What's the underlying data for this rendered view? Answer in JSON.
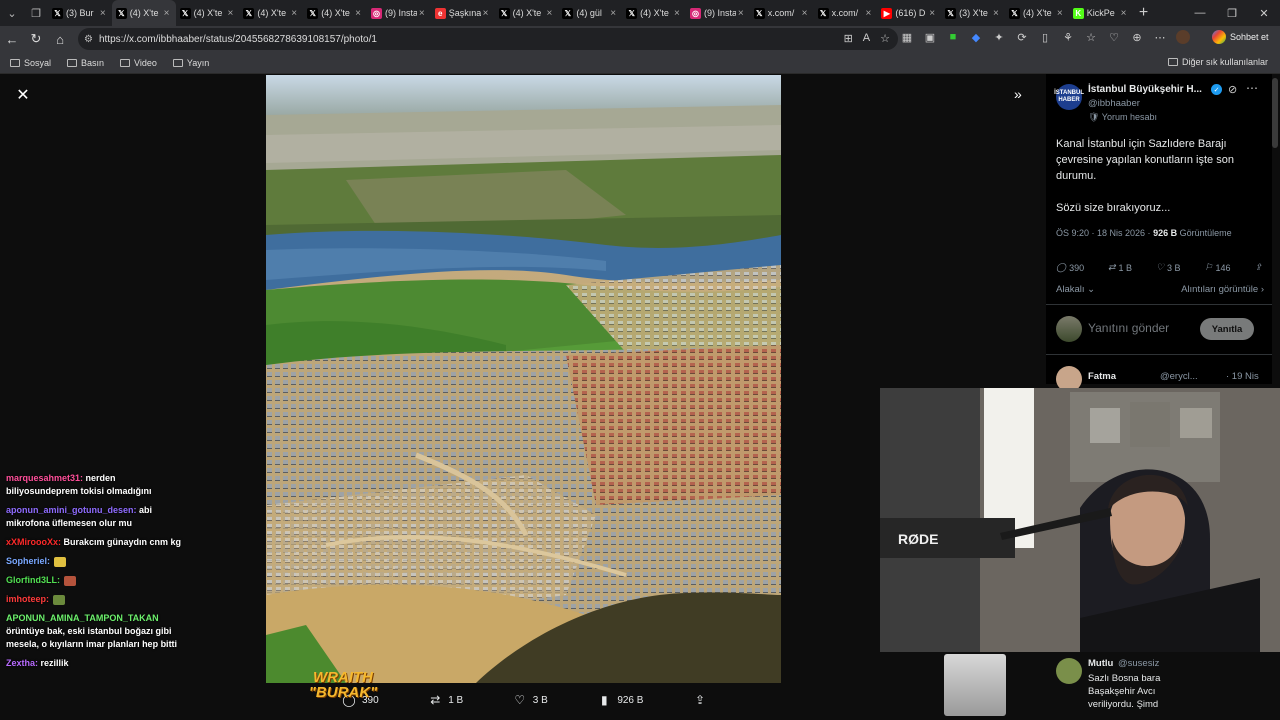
{
  "browser": {
    "tabs": [
      {
        "title": "(3) Bur",
        "icon": "x",
        "active": false
      },
      {
        "title": "(4) X'te",
        "icon": "x",
        "active": true
      },
      {
        "title": "(4) X'te",
        "icon": "x",
        "active": false
      },
      {
        "title": "(4) X'te",
        "icon": "x",
        "active": false
      },
      {
        "title": "(4) X'te",
        "icon": "x",
        "active": false
      },
      {
        "title": "(9) Insta",
        "icon": "instagram",
        "active": false
      },
      {
        "title": "Şaşkına",
        "icon": "ekşi",
        "active": false
      },
      {
        "title": "(4) X'te",
        "icon": "x",
        "active": false
      },
      {
        "title": "(4) gül",
        "icon": "x",
        "active": false
      },
      {
        "title": "(4) X'te",
        "icon": "x",
        "active": false
      },
      {
        "title": "(9) Insta",
        "icon": "instagram",
        "active": false
      },
      {
        "title": "x.com/",
        "icon": "x",
        "active": false
      },
      {
        "title": "x.com/",
        "icon": "x",
        "active": false
      },
      {
        "title": "(616) D",
        "icon": "youtube",
        "active": false
      },
      {
        "title": "(3) X'te",
        "icon": "x",
        "active": false
      },
      {
        "title": "(4) X'te",
        "icon": "x",
        "active": false
      },
      {
        "title": "KickPe",
        "icon": "kick",
        "active": false
      }
    ],
    "url": "https://x.com/ibbhaaber/status/2045568278639108157/photo/1",
    "chat_button": "Sohbet et",
    "bookmarks": [
      "Sosyal",
      "Basın",
      "Video",
      "Yayın"
    ],
    "bookmarks_other": "Diğer sık kullanılanlar"
  },
  "photo_view": {
    "actions": {
      "replies": "390",
      "reposts": "1 B",
      "likes": "3 B",
      "views": "926 B"
    }
  },
  "tweet": {
    "author": "İstanbul Büyükşehir H...",
    "handle": "@ibbhaaber",
    "affiliation": "Yorum hesabı",
    "avatar_text": "İSTANBUL HABER",
    "text_line1": "Kanal İstanbul için Sazlıdere Barajı çevresine yapılan konutların işte son durumu.",
    "text_line2": "Sözü size bırakıyoruz...",
    "time": "ÖS 9:20 · 18 Nis 2026 · ",
    "views": "926 B",
    "views_label": " Görüntüleme",
    "replies": "390",
    "reposts": "1 B",
    "likes": "3 B",
    "bookmarks": "146",
    "related": "Alakalı",
    "quotes": "Alıntıları görüntüle",
    "reply_placeholder": "Yanıtını gönder",
    "reply_button": "Yanıtla"
  },
  "comments": [
    {
      "name": "Fatma",
      "handle": "@erycl...",
      "date": "· 19 Nis"
    },
    {
      "name": "Mutlu",
      "handle": "@susesiz",
      "text": "Sazlı Bosna bara Başakşehir Avcı veriliyordu. Şimd"
    }
  ],
  "stream_chat": [
    {
      "user": "marquesahmet31:",
      "color": "#ff4f9a",
      "text": " nerden biliyosundeprem tokisi olmadığını"
    },
    {
      "user": "aponun_amini_gotunu_desen:",
      "color": "#8f6cff",
      "text": " abi mikrofona üflemesen olur mu"
    },
    {
      "user": "xXMiroooXx:",
      "color": "#ff2a2a",
      "text": " Burakcım günaydın cnm kg"
    },
    {
      "user": "Sopheriel:",
      "color": "#7aa8ff",
      "text": ""
    },
    {
      "user": "Glorfind3LL:",
      "color": "#52e052",
      "text": ""
    },
    {
      "user": "imhoteep:",
      "color": "#ff3b3b",
      "text": ""
    },
    {
      "user": "APONUN_AMINA_TAMPON_TAKAN",
      "color": "#6cf06c",
      "text": " örüntüye bak, eski istanbul boğazı gibi mesela, o kıyıların imar planları hep bitti"
    },
    {
      "user": "Zextha:",
      "color": "#b86bff",
      "text": " rezillik"
    }
  ],
  "webcam": {
    "mic_brand": "RØDE",
    "overlay_logo_line1": "WRAITH",
    "overlay_logo_line2": "\"BURAK\""
  },
  "colors": {
    "x_blue": "#1d9bf0",
    "background": "#0d0d0d",
    "text_primary": "#e7e9ea",
    "text_secondary": "#8b98a5"
  }
}
